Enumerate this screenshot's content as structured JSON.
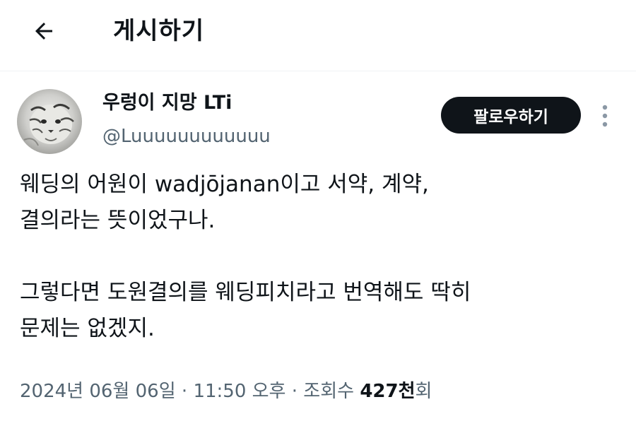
{
  "header": {
    "title": "게시하기",
    "back_icon": "arrow-left-icon"
  },
  "author": {
    "display_name": "우렁이 지망 LTi",
    "handle": "@Luuuuuuuuuuuu",
    "avatar": "tiger-avatar"
  },
  "follow_button": {
    "label": "팔로우하기"
  },
  "more_icon": "more-vertical-icon",
  "tweet": {
    "paragraph1_line1": "웨딩의 어원이 wadjōjanan이고 서약, 계약,",
    "paragraph1_line2": "결의라는 뜻이었구나.",
    "paragraph2_line1": "그렇다면 도원결의를 웨딩피치라고 번역해도 딱히",
    "paragraph2_line2": "문제는 없겠지."
  },
  "meta": {
    "date": "2024년 06월 06일",
    "separator1": "·",
    "time": "11:50 오후",
    "separator2": "·",
    "views_label": "조회수",
    "views_count": "427천",
    "views_suffix": "회"
  },
  "colors": {
    "text_primary": "#0f1419",
    "text_secondary": "#536471",
    "button_bg": "#0f1419",
    "button_text": "#ffffff",
    "divider": "#eff3f4"
  }
}
